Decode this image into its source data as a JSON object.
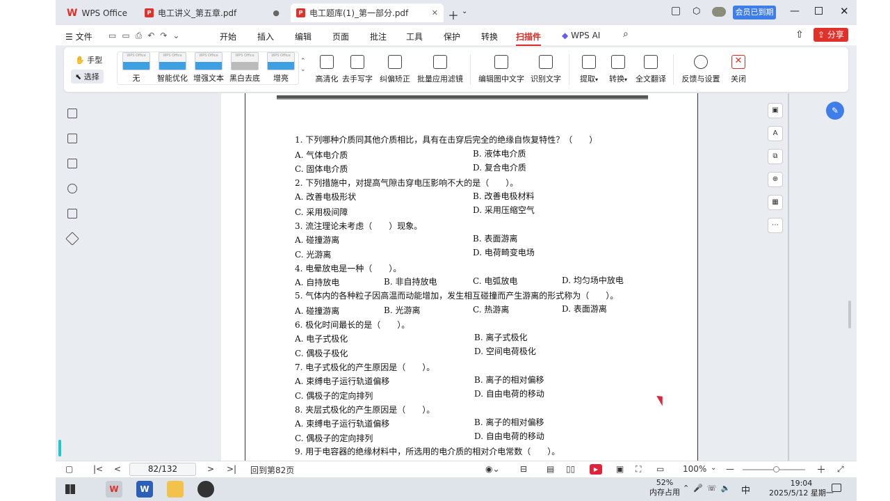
{
  "tabs": [
    {
      "label": "WPS Office"
    },
    {
      "label": "电工讲义_第五章.pdf"
    },
    {
      "label": "电工题库(1)_第一部分.pdf"
    }
  ],
  "member": "会员已到期",
  "menu": {
    "file": "文件",
    "items": [
      "开始",
      "插入",
      "编辑",
      "页面",
      "批注",
      "工具",
      "保护",
      "转换",
      "扫描件",
      "WPS AI"
    ],
    "share": "分享"
  },
  "ribbon": {
    "hand": "手型",
    "select": "选择",
    "filters": [
      "无",
      "智能优化",
      "增强文本",
      "黑白去底",
      "增亮"
    ],
    "thumb_text": "WPS Office",
    "tools": [
      "高清化",
      "去手写字",
      "纠偏矫正",
      "批量应用滤镜",
      "编辑图中文字",
      "识别文字",
      "提取",
      "转换",
      "全文翻译",
      "反馈与设置",
      "关闭"
    ]
  },
  "doc_lines": [
    "1. 下列哪种介质同其他介质相比，具有在击穿后完全的绝缘自恢复特性？（　　）",
    "A. 气体电介质",
    "B. 液体电介质",
    "C. 固体电介质",
    "D. 复合电介质",
    "2. 下列措施中，对提高气隙击穿电压影响不大的是（　　）。",
    "A. 改善电极形状",
    "B. 改善电极材料",
    "C. 采用极间障",
    "D. 采用压缩空气",
    "3. 流注理论未考虑（　　）现象。",
    "A. 碰撞游离",
    "B. 表面游离",
    "C. 光游离",
    "D. 电荷畸变电场",
    "4. 电晕放电是一种（　　）。",
    "A. 自持放电",
    "B. 非自持放电",
    "C. 电弧放电",
    "D. 均匀场中放电",
    "5. 气体内的各种粒子因高温而动能增加，发生相互碰撞而产生游离的形式称为（　　）。",
    "A. 碰撞游离",
    "B. 光游离",
    "C. 热游离",
    "D. 表面游离",
    "6. 极化时间最长的是（　　）。",
    "A. 电子式极化",
    "B. 离子式极化",
    "C. 偶极子极化",
    "D. 空间电荷极化",
    "7. 电子式极化的产生原因是（　　）。",
    "A. 束缚电子运行轨道偏移",
    "B. 离子的相对偏移",
    "C. 偶极子的定向排列",
    "D. 自由电荷的移动",
    "8. 夹层式极化的产生原因是（　　）。",
    "A. 束缚电子运行轨道偏移",
    "B. 离子的相对偏移",
    "C. 偶极子的定向排列",
    "D. 自由电荷的移动",
    "9. 用于电容器的绝缘材料中，所选用的电介质的相对介电常数（　　）。"
  ],
  "status": {
    "page": "82/132",
    "back": "回到第82页",
    "zoom": "100%"
  },
  "taskbar": {
    "mem": "52%",
    "mem_label": "内存占用",
    "ime": "中",
    "time": "19:04",
    "date": "2025/5/12 星期一"
  }
}
